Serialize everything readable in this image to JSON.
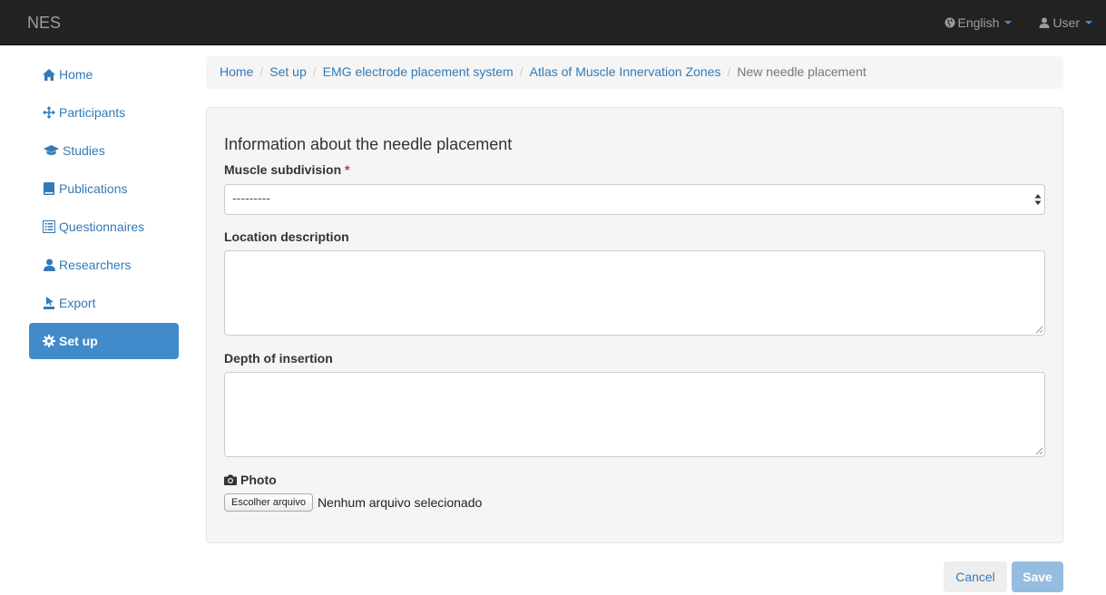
{
  "navbar": {
    "brand": "NES",
    "language_label": "English",
    "user_label": "User"
  },
  "sidebar": {
    "items": [
      {
        "label": "Home",
        "icon": "home-icon"
      },
      {
        "label": "Participants",
        "icon": "move-icon"
      },
      {
        "label": "Studies",
        "icon": "graduation-cap-icon"
      },
      {
        "label": "Publications",
        "icon": "book-icon"
      },
      {
        "label": "Questionnaires",
        "icon": "list-alt-icon"
      },
      {
        "label": "Researchers",
        "icon": "user-icon"
      },
      {
        "label": "Export",
        "icon": "export-icon"
      },
      {
        "label": "Set up",
        "icon": "cog-icon"
      }
    ],
    "active_index": 7
  },
  "breadcrumb": {
    "items": [
      "Home",
      "Set up",
      "EMG electrode placement system",
      "Atlas of Muscle Innervation Zones"
    ],
    "current": "New needle placement"
  },
  "form": {
    "title": "Information about the needle placement",
    "muscle_subdivision_label": "Muscle subdivision",
    "required_marker": "*",
    "muscle_subdivision_value": "---------",
    "location_description_label": "Location description",
    "location_description_value": "",
    "depth_of_insertion_label": "Depth of insertion",
    "depth_of_insertion_value": "",
    "photo_label": "Photo",
    "file_button_label": "Escolher arquivo",
    "file_status": "Nenhum arquivo selecionado"
  },
  "actions": {
    "cancel_label": "Cancel",
    "save_label": "Save"
  },
  "colors": {
    "navbar_bg": "#222222",
    "link": "#337ab7",
    "active_bg": "#428bca",
    "save_disabled_bg": "#95bde0",
    "panel_bg": "#f5f5f5"
  }
}
